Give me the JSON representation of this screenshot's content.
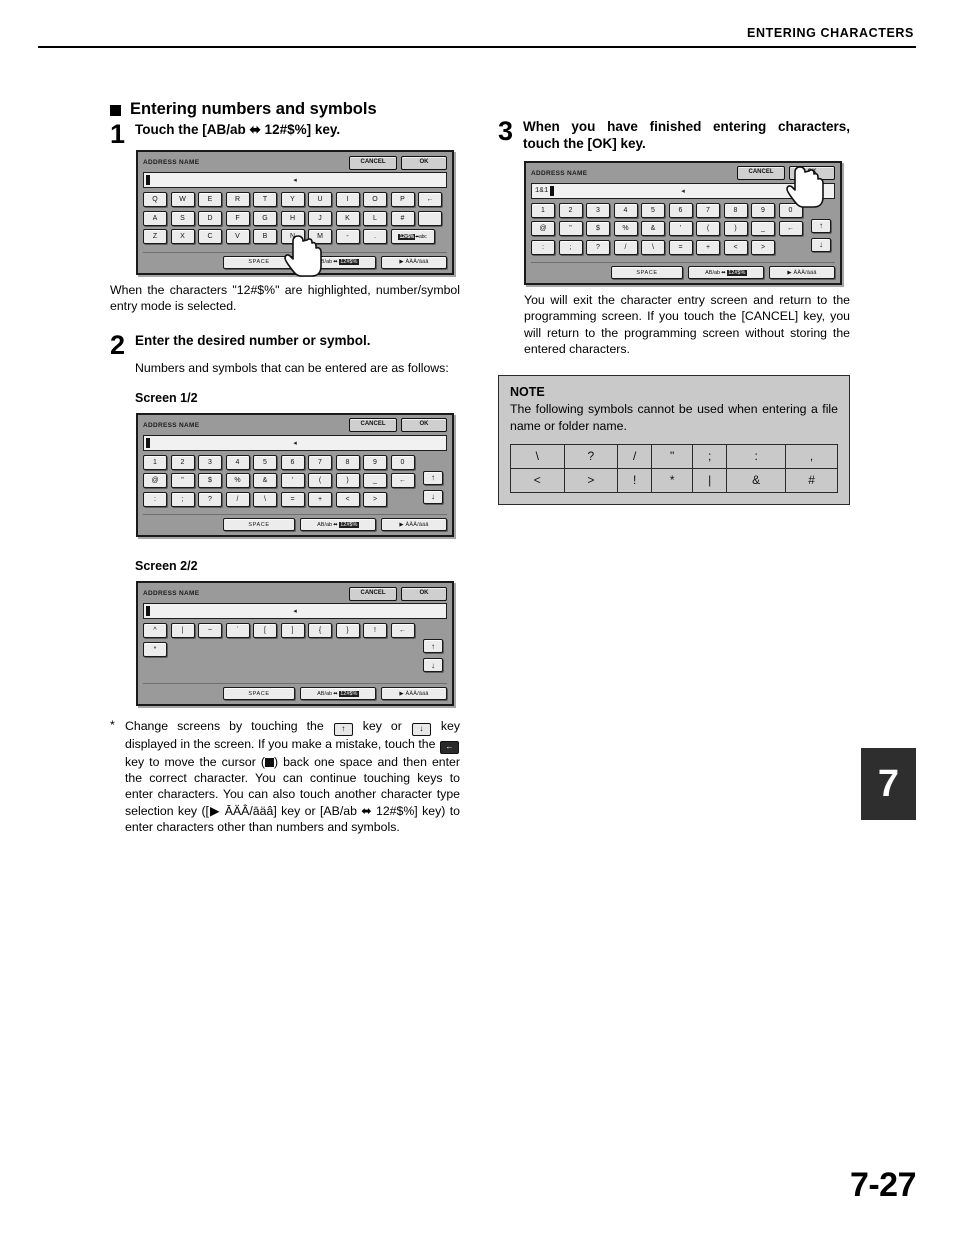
{
  "header": {
    "title": "ENTERING CHARACTERS"
  },
  "section": {
    "heading": "Entering numbers and symbols"
  },
  "steps": {
    "one": {
      "number": "1",
      "heading": "Touch the [AB/ab ⬌ 12#$%] key.",
      "body": "When the characters \"12#$%\" are highlighted, number/symbol entry mode is selected."
    },
    "two": {
      "number": "2",
      "heading": "Enter the desired number or symbol.",
      "body": "Numbers and symbols that can be entered are as follows:",
      "screen_1_label": "Screen 1/2",
      "screen_2_label": "Screen 2/2"
    },
    "three": {
      "number": "3",
      "heading": "When you have finished entering characters, touch the [OK] key.",
      "body": "You will exit the character entry screen and return to the programming screen. If you touch the [CANCEL] key, you will return to the programming screen without storing the entered characters."
    }
  },
  "device_screen": {
    "title": "ADDRESS NAME",
    "cancel_label": "CANCEL",
    "ok_label": "OK",
    "space_label": "SPACE",
    "mode_key": {
      "left": "AB/ab",
      "arrows": "⬌",
      "right": "12#$%"
    },
    "accent_key": "▶ ĀÄÂ/āäâ",
    "backspace_glyph": "←",
    "up_glyph": "↑",
    "down_glyph": "↓",
    "entered_text": "1&1",
    "keyboard_alpha": {
      "row1": [
        "Q",
        "W",
        "E",
        "R",
        "T",
        "Y",
        "U",
        "I",
        "O",
        "P"
      ],
      "row2": [
        "A",
        "S",
        "D",
        "F",
        "G",
        "H",
        "J",
        "K",
        "L",
        "#"
      ],
      "row3": [
        "Z",
        "X",
        "C",
        "V",
        "B",
        "N",
        "M",
        "-",
        "."
      ]
    },
    "keyboard_sym_1": {
      "row1": [
        "1",
        "2",
        "3",
        "4",
        "5",
        "6",
        "7",
        "8",
        "9",
        "0"
      ],
      "row2": [
        "@",
        "\"",
        "$",
        "%",
        "&",
        "'",
        "(",
        ")",
        "_"
      ],
      "row3": [
        ":",
        ";",
        "?",
        "/",
        "\\",
        "=",
        "+",
        "<",
        ">"
      ]
    },
    "keyboard_sym_2": {
      "row1": [
        "^",
        "|",
        "~",
        "`",
        "[",
        "]",
        "{",
        "}",
        "!"
      ],
      "row2": [
        "*"
      ]
    }
  },
  "note": {
    "label": "NOTE",
    "text": "The following symbols cannot be used when entering a file name or folder name.",
    "symbols_row1": [
      "\\",
      "?",
      "/",
      "\"",
      ";",
      ":",
      ","
    ],
    "symbols_row2": [
      "<",
      ">",
      "!",
      "*",
      "|",
      "&",
      "#"
    ]
  },
  "footnote": {
    "marker": "*",
    "p1_a": "Change screens by touching the",
    "p1_b": "key or",
    "p1_c": "key displayed in the screen. If you make a mistake, touch the",
    "p1_d": "key to move the cursor (",
    "p1_e": ") back one space and then enter the correct character.",
    "p2": "You can continue touching keys to enter characters. You can also touch another character type selection key ([▶ ĀÄÂ/āäâ] key or [AB/ab ⬌ 12#$%] key) to enter characters other than numbers and symbols."
  },
  "chapter_tab": "7",
  "page_number": "7-27"
}
